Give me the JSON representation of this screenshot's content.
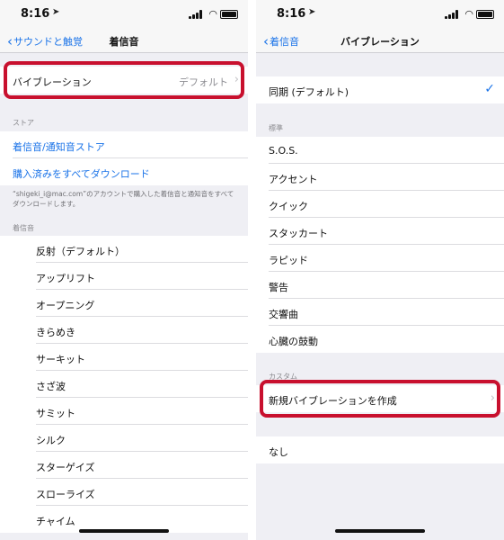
{
  "left": {
    "status": {
      "time": "8:16"
    },
    "nav": {
      "back": "サウンドと触覚",
      "title": "着信音"
    },
    "vibration_row": {
      "label": "バイブレーション",
      "value": "デフォルト"
    },
    "store_header": "ストア",
    "store_items": [
      "着信音/通知音ストア",
      "購入済みをすべてダウンロード"
    ],
    "store_footer": "“shigeki_i@mac.com”のアカウントで購入した着信音と通知音をすべてダウンロードします。",
    "ringtone_header": "着信音",
    "ringtones": [
      "反射（デフォルト）",
      "アップリフト",
      "オープニング",
      "きらめき",
      "サーキット",
      "さざ波",
      "サミット",
      "シルク",
      "スターゲイズ",
      "スローライズ",
      "チャイム"
    ]
  },
  "right": {
    "status": {
      "time": "8:16"
    },
    "nav": {
      "back": "着信音",
      "title": "バイブレーション"
    },
    "sync_row": "同期 (デフォルト)",
    "standard_header": "標準",
    "standard_items": [
      "S.O.S.",
      "アクセント",
      "クイック",
      "スタッカート",
      "ラピッド",
      "警告",
      "交響曲",
      "心臓の鼓動"
    ],
    "custom_header": "カスタム",
    "custom_item": "新規バイブレーションを作成",
    "none_item": "なし"
  },
  "colors": {
    "accent": "#1a73e8",
    "highlight": "#c8102e"
  },
  "icons": [
    "location-arrow-icon",
    "signal-icon",
    "wifi-icon",
    "battery-icon",
    "back-chevron-icon",
    "chevron-right-icon",
    "checkmark-icon"
  ]
}
